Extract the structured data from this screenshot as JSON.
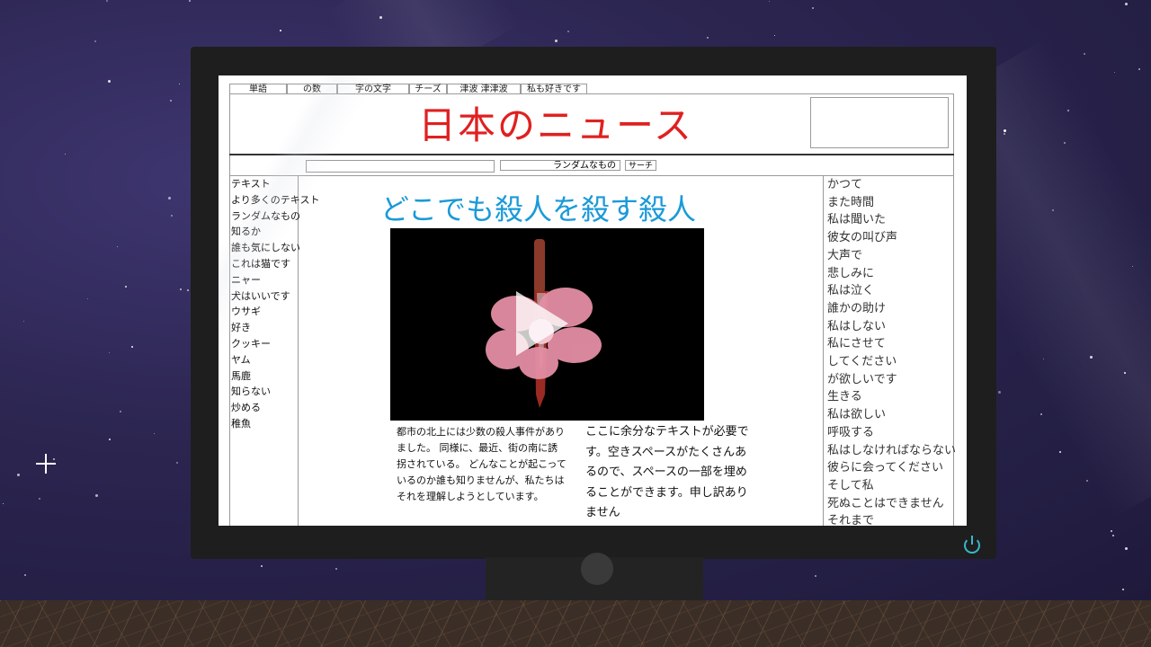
{
  "browser": {
    "tabs": [
      "単語",
      "の数",
      "字の文字",
      "チーズ",
      "津波 津津波",
      "私も好きです"
    ]
  },
  "site": {
    "title": "日本のニュース",
    "random_button": "ランダムなもの",
    "search_button": "サーチ",
    "search_value": ""
  },
  "left_nav": [
    "テキスト",
    "より多くのテキスト",
    "ランダムなもの",
    "知るか",
    "誰も気にしない",
    "これは猫です",
    "ニャー",
    "犬はいいです",
    "ウサギ",
    "好き",
    "クッキー",
    "ヤム",
    "馬鹿",
    "知らない",
    "炒める",
    "稚魚"
  ],
  "article": {
    "headline": "どこでも殺人を殺す殺人",
    "body_left": "都市の北上には少数の殺人事件がありました。 同様に、最近、街の南に誘拐されている。 どんなことが起こっているのか誰も知りませんが、私たちはそれを理解しようとしています。",
    "body_right": "ここに余分なテキストが必要です。空きスペースがたくさんあるので、スペースの一部を埋めることができます。申し訳ありません"
  },
  "right_col": [
    "かつて",
    "また時間",
    "私は聞いた",
    "彼女の叫び声",
    "大声で",
    "悲しみに",
    "私は泣く",
    "誰かの助け",
    "私はしない",
    "私にさせて",
    "してください",
    "が欲しいです",
    "生きる",
    "私は欲しい",
    "呼吸する",
    "私はしなければならない",
    "彼らに会ってください",
    "そして私",
    "死ぬことはできません",
    "それまで"
  ],
  "colors": {
    "title": "#e02020",
    "headline": "#1a9ad8",
    "power": "#39b7c9"
  }
}
